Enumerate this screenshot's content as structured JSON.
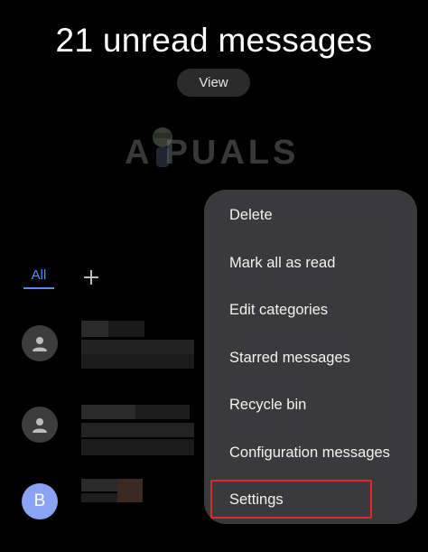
{
  "header": {
    "title": "21 unread messages",
    "view_label": "View"
  },
  "watermark": {
    "text": "A PUALS"
  },
  "tabs": {
    "all_label": "All",
    "add_icon": "plus-icon",
    "accent": "#4e8ef5"
  },
  "conversations": [
    {
      "avatar": "person-icon"
    },
    {
      "avatar": "person-icon"
    },
    {
      "avatar_letter": "B"
    }
  ],
  "menu": {
    "items": [
      {
        "label": "Delete"
      },
      {
        "label": "Mark all as read"
      },
      {
        "label": "Edit categories"
      },
      {
        "label": "Starred messages"
      },
      {
        "label": "Recycle bin"
      },
      {
        "label": "Configuration messages"
      },
      {
        "label": "Settings"
      }
    ],
    "highlight_color": "#e0272e"
  }
}
